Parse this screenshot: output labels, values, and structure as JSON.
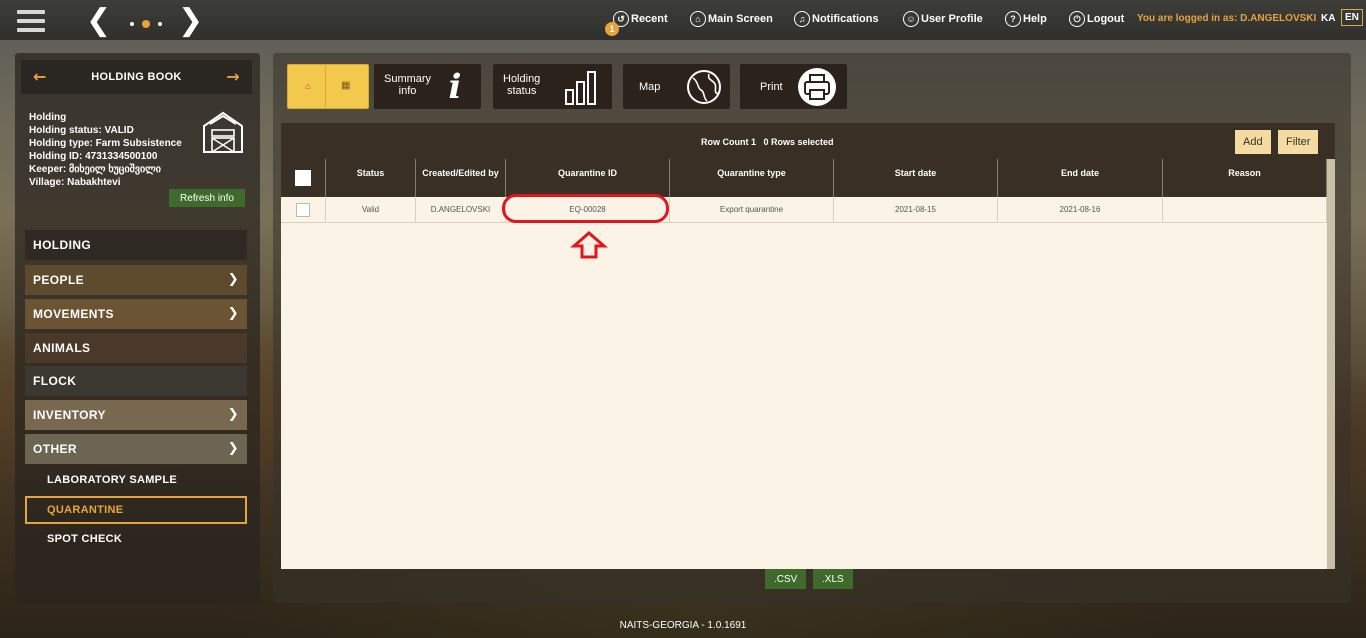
{
  "topbar": {
    "recent": "Recent",
    "recent_badge": "1",
    "main_screen": "Main Screen",
    "notifications": "Notifications",
    "user_profile": "User Profile",
    "help": "Help",
    "logout": "Logout",
    "logged_in": "You are logged in as: D.ANGELOVSKI",
    "lang_ka": "KA",
    "lang_en": "EN"
  },
  "sidebar": {
    "title": "HOLDING BOOK",
    "info": [
      "Holding",
      "Holding status: VALID",
      "Holding type: Farm Subsistence",
      "Holding ID: 4731334500100",
      "Keeper: მიხეილ ხუციშვილი",
      "Village: Nabakhtevi"
    ],
    "refresh": "Refresh info",
    "items": [
      "HOLDING",
      "PEOPLE",
      "MOVEMENTS",
      "ANIMALS",
      "FLOCK",
      "INVENTORY",
      "OTHER"
    ],
    "subitems": [
      "LABORATORY SAMPLE",
      "QUARANTINE",
      "SPOT CHECK"
    ]
  },
  "toolbar": {
    "summary": [
      "Summary",
      "info"
    ],
    "holding_status": [
      "Holding",
      "status"
    ],
    "map": "Map",
    "print": "Print"
  },
  "grid": {
    "row_count": "Row Count 1",
    "rows_selected": "0 Rows selected",
    "add": "Add",
    "filter": "Filter",
    "columns": [
      "Status",
      "Created/Edited by",
      "Quarantine ID",
      "Quarantine type",
      "Start date",
      "End date",
      "Reason"
    ],
    "rows": [
      [
        "Valid",
        "D.ANGELOVSKI",
        "EQ-00028",
        "Export quarantine",
        "2021-08-15",
        "2021-08-16",
        ""
      ]
    ]
  },
  "export": {
    "csv": ".CSV",
    "xls": ".XLS"
  },
  "footer": "NAITS-GEORGIA - 1.0.1691",
  "colors": {
    "accent": "#e8a43c",
    "highlight": "#e3141c",
    "green": "#3e6b2c"
  }
}
